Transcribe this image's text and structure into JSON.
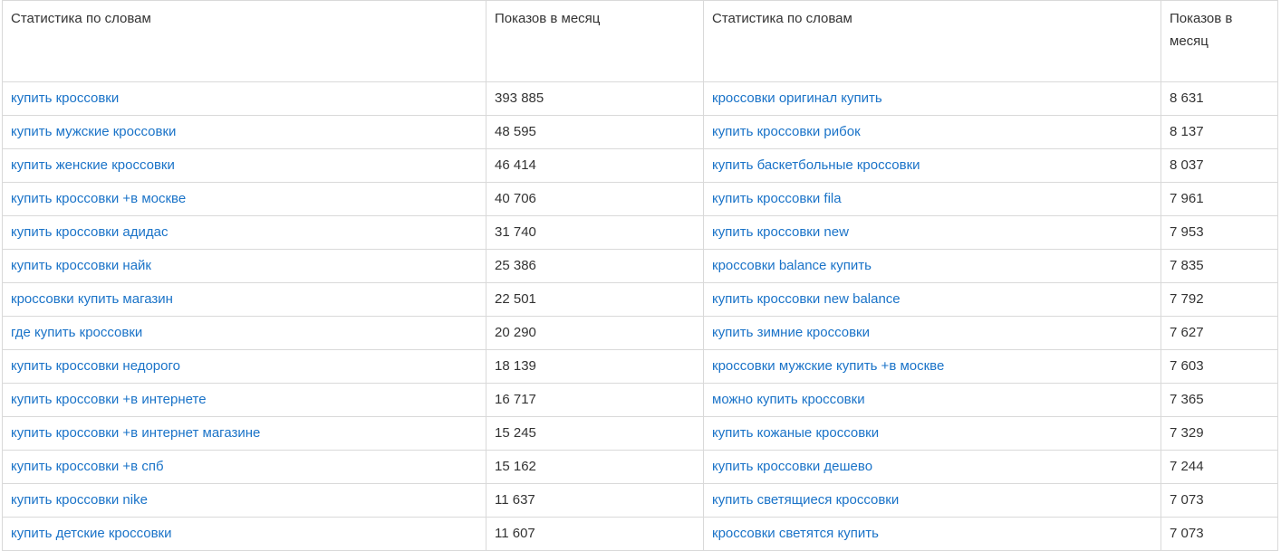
{
  "table": {
    "headers": [
      "Статистика по словам",
      "Показов в месяц",
      "Статистика по словам",
      "Показов в месяц"
    ],
    "rows": [
      {
        "left_keyword": "купить кроссовки",
        "left_count": "393 885",
        "right_keyword": "кроссовки оригинал купить",
        "right_count": "8 631"
      },
      {
        "left_keyword": "купить мужские кроссовки",
        "left_count": "48 595",
        "right_keyword": "купить кроссовки рибок",
        "right_count": "8 137"
      },
      {
        "left_keyword": "купить женские кроссовки",
        "left_count": "46 414",
        "right_keyword": "купить баскетбольные кроссовки",
        "right_count": "8 037"
      },
      {
        "left_keyword": "купить кроссовки +в москве",
        "left_count": "40 706",
        "right_keyword": "купить кроссовки fila",
        "right_count": "7 961"
      },
      {
        "left_keyword": "купить кроссовки адидас",
        "left_count": "31 740",
        "right_keyword": "купить кроссовки new",
        "right_count": "7 953"
      },
      {
        "left_keyword": "купить кроссовки найк",
        "left_count": "25 386",
        "right_keyword": "кроссовки balance купить",
        "right_count": "7 835"
      },
      {
        "left_keyword": "кроссовки купить магазин",
        "left_count": "22 501",
        "right_keyword": "купить кроссовки new balance",
        "right_count": "7 792"
      },
      {
        "left_keyword": "где купить кроссовки",
        "left_count": "20 290",
        "right_keyword": "купить зимние кроссовки",
        "right_count": "7 627"
      },
      {
        "left_keyword": "купить кроссовки недорого",
        "left_count": "18 139",
        "right_keyword": "кроссовки мужские купить +в москве",
        "right_count": "7 603"
      },
      {
        "left_keyword": "купить кроссовки +в интернете",
        "left_count": "16 717",
        "right_keyword": "можно купить кроссовки",
        "right_count": "7 365"
      },
      {
        "left_keyword": "купить кроссовки +в интернет магазине",
        "left_count": "15 245",
        "right_keyword": "купить кожаные кроссовки",
        "right_count": "7 329"
      },
      {
        "left_keyword": "купить кроссовки +в спб",
        "left_count": "15 162",
        "right_keyword": "купить кроссовки дешево",
        "right_count": "7 244"
      },
      {
        "left_keyword": "купить кроссовки nike",
        "left_count": "11 637",
        "right_keyword": "купить светящиеся кроссовки",
        "right_count": "7 073"
      },
      {
        "left_keyword": "купить детские кроссовки",
        "left_count": "11 607",
        "right_keyword": "кроссовки светятся купить",
        "right_count": "7 073"
      }
    ]
  },
  "colors": {
    "link": "#1a73c8",
    "text": "#333333",
    "border": "#d9d9d9"
  }
}
